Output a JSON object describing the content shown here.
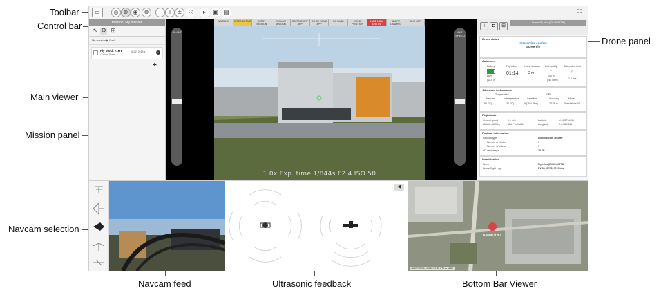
{
  "callouts": {
    "toolbar": "Toolbar",
    "control_bar": "Control bar",
    "main_viewer": "Main viewer",
    "mission_panel": "Mission panel",
    "navcam_selection": "Navcam selection",
    "drone_panel": "Drone panel",
    "navcam_feed": "Navcam feed",
    "ultrasonic_feedback": "Ultrasonic feedback",
    "bottom_bar_viewer": "Bottom Bar Viewer"
  },
  "mission_panel": {
    "title": "Mission: My mission",
    "breadcrumb": "My mission  ▶  Back",
    "item_name": "Fly block #1HY",
    "item_sub": "Custom Route",
    "item_time": "08:02, 2418 s"
  },
  "status_strip": [
    "WARNING",
    "INTER-ACTIVE",
    "START MISSION",
    "RESUME MISSION",
    "GO TO START APP",
    "GO TO HOME APP",
    "GO LAND",
    "HOLD POSITION",
    "LAND NOW END DL",
    "ABORT LANDING",
    "TAKE OFF"
  ],
  "scales": {
    "left_label": "GL ALT",
    "right_label": "ALT SPEED"
  },
  "exposure": "1.0x   Exp. time 1/844s   F2.4   ISO 50",
  "drone_panel": {
    "title": "Drone: Fly elios (EX-00-08738)",
    "drone_status_title": "Drone status",
    "status_line1": "Interactive control",
    "status_line2": "Screenfly",
    "autonomy_title": "Autonomy",
    "battery_label": "Battery",
    "battery_value": "88 %",
    "battery_sub": "(11.4 V)",
    "flight_time_label": "Flight time",
    "flight_time_value": "01:14",
    "home_distance_label": "Home distance",
    "home_distance_value": "2 m",
    "home_distance_sub": "(--)",
    "link_quality_label": "Link quality",
    "link_quality_value": "100 %",
    "link_quality_sub": "(-48 dBm)",
    "wind_label": "Estimated wind",
    "wind_value": "1.4 m/s",
    "instruments_title": "Advanced instruments",
    "temperature_label": "Temperature",
    "gps_label": "GPS",
    "pressure_label": "Pressure",
    "pressure_value": "80 (°C)",
    "in_temp_label": "In temperature",
    "in_temp_value": "37 (°C)",
    "satellites_label": "Satellites",
    "satellites_value": "8 (26.4 dBm)",
    "accuracy_label": "Accuracy",
    "accuracy_value": "2.148 m",
    "mode_label": "Mode",
    "mode_value": "Standalone 3D",
    "flight_data_title": "Flight data",
    "ground_speed_label": "Ground speed",
    "ground_speed_value": "0.1 m/s",
    "altitude_label": "Altitude (AMSL)",
    "altitude_value": "584.7 m AMSL",
    "latitude_label": "Latitude",
    "latitude_value": "N 46.5774451",
    "longitude_label": "Longitude",
    "longitude_value": "E 6.5861111",
    "payload_title": "Payload information",
    "payload_type_label": "Payload type",
    "payload_type_value": "elios navcam 36.4 HP",
    "photos_label": "Number of photos",
    "photos_value": "0",
    "videos_label": "Number of videos",
    "videos_value": "0",
    "sd_label": "SD card usage",
    "sd_value": "25.7%",
    "ident_title": "Identification",
    "name_label": "Name",
    "name_value": "Fly elios (EX-00-08738)",
    "log_label": "Drone Flight Log",
    "log_value": "EX-00-08738_0231.bbx"
  },
  "map": {
    "coords": "46.577450°N, 6.586111°E, 573 m AMSL",
    "marker_label": "FLYABILITY HQ"
  },
  "colors": {
    "status_blue": "#1a8fd6",
    "good_green": "#2a9a3c",
    "alert_red": "#d84444",
    "warn_yellow": "#e8c84c"
  }
}
